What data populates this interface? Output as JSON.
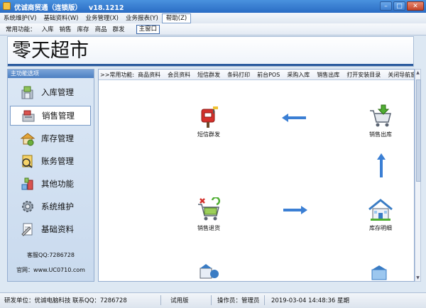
{
  "window": {
    "title": "优诚商贸通（连锁版）",
    "version": "v18.1212"
  },
  "menubar": {
    "items": [
      "系统维护(V)",
      "基础资料(W)",
      "业务管理(X)",
      "业务报表(Y)",
      "帮助(Z)"
    ]
  },
  "toolbar": {
    "label": "常用功能：",
    "items": [
      "入库",
      "销售",
      "库存",
      "商品",
      "群发"
    ],
    "main_button": "主窗口"
  },
  "banner": {
    "title": "零天超市"
  },
  "sidebar": {
    "header": "主功能选项",
    "items": [
      {
        "label": "入库管理",
        "icon": "warehouse-in-icon"
      },
      {
        "label": "销售管理",
        "icon": "cash-register-icon"
      },
      {
        "label": "库存管理",
        "icon": "stock-icon"
      },
      {
        "label": "账务管理",
        "icon": "ledger-icon"
      },
      {
        "label": "其他功能",
        "icon": "tools-icon"
      },
      {
        "label": "系统维护",
        "icon": "gear-icon"
      },
      {
        "label": "基础资料",
        "icon": "document-icon"
      }
    ],
    "selected": "销售管理",
    "service_qq": "客服QQ:7286728",
    "website": "官网：www.UC0710.com"
  },
  "quickbar": {
    "label": ">>常用功能:",
    "items": [
      "商品资料",
      "会员资料",
      "短信群发",
      "条码打印",
      "前台POS",
      "采购入库",
      "销售出库",
      "打开安装目录",
      "关闭导航窗口"
    ]
  },
  "flow": {
    "nodes": [
      {
        "label": "短信群发",
        "icon": "mailbox-icon"
      },
      {
        "label": "销售出库",
        "icon": "cart-out-icon"
      },
      {
        "label": "销售退货",
        "icon": "cart-return-icon"
      },
      {
        "label": "库存明细",
        "icon": "house-icon"
      }
    ]
  },
  "statusbar": {
    "developer": "研发单位：优诚电脑科技",
    "contact": "联系QQ：7286728",
    "edition": "试用版",
    "operator": "操作员：管理员",
    "datetime": "2019-03-04 14:48:36 星期"
  },
  "colors": {
    "accent": "#2a6cc4",
    "arrow": "#3b7fd4"
  }
}
